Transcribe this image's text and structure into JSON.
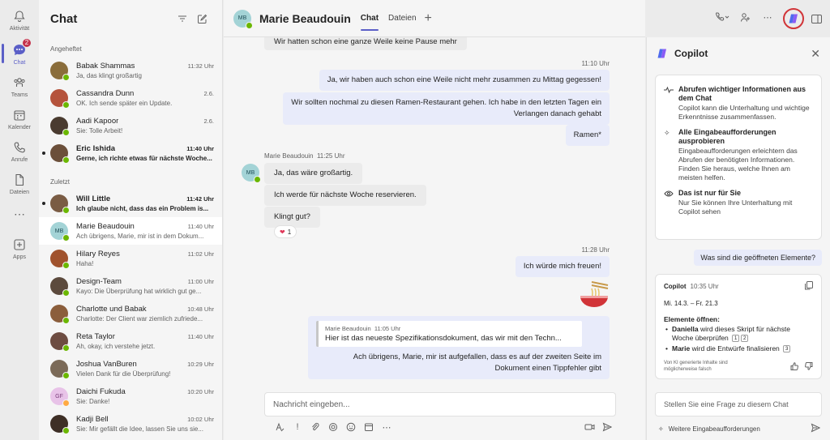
{
  "rail": {
    "items": [
      {
        "label": "Aktivität",
        "icon": "bell-icon"
      },
      {
        "label": "Chat",
        "icon": "chat-icon",
        "badge": "2"
      },
      {
        "label": "Teams",
        "icon": "teams-icon"
      },
      {
        "label": "Kalender",
        "icon": "calendar-icon"
      },
      {
        "label": "Anrufe",
        "icon": "phone-icon"
      },
      {
        "label": "Dateien",
        "icon": "file-icon"
      },
      {
        "label": "Apps",
        "icon": "plus-square-icon"
      }
    ]
  },
  "list": {
    "title": "Chat",
    "pinned_label": "Angeheftet",
    "recent_label": "Zuletzt",
    "pinned": [
      {
        "name": "Babak Shammas",
        "time": "11:32 Uhr",
        "preview": "Ja, das klingt großartig",
        "color": "#8a6d3b",
        "bold": false
      },
      {
        "name": "Cassandra Dunn",
        "time": "2.6.",
        "preview": "OK. Ich sende später ein Update.",
        "color": "#b5533c",
        "bold": false
      },
      {
        "name": "Aadi Kapoor",
        "time": "2.6.",
        "preview": "Sie: Tolle Arbeit!",
        "color": "#4a3b30",
        "bold": false
      },
      {
        "name": "Eric Ishida",
        "time": "11:40 Uhr",
        "preview": "Gerne, ich richte etwas für nächste Woche...",
        "color": "#6b4f3a",
        "bold": true
      }
    ],
    "recent": [
      {
        "name": "Will Little",
        "time": "11:42 Uhr",
        "preview": "Ich glaube nicht, dass das ein Problem is...",
        "color": "#7a5c44",
        "bold": true
      },
      {
        "name": "Marie Beaudouin",
        "time": "11:40 Uhr",
        "preview": "Ach übrigens, Marie, mir ist in dem Dokum...",
        "initials": "MB",
        "color": "#a3d3d6",
        "bold": false,
        "selected": true
      },
      {
        "name": "Hilary Reyes",
        "time": "11:02 Uhr",
        "preview": "Haha!",
        "color": "#a0522d",
        "bold": false
      },
      {
        "name": "Design-Team",
        "time": "11:00 Uhr",
        "preview": "Kayo: Die Überprüfung hat wirklich gut ge...",
        "color": "#5c4a3d",
        "bold": false
      },
      {
        "name": "Charlotte und Babak",
        "time": "10:48 Uhr",
        "preview": "Charlotte: Der Client war ziemlich zufriede...",
        "color": "#8b5e3c",
        "bold": false
      },
      {
        "name": "Reta Taylor",
        "time": "11:40 Uhr",
        "preview": "Ah, okay, ich verstehe jetzt.",
        "color": "#6d4c41",
        "bold": false
      },
      {
        "name": "Joshua VanBuren",
        "time": "10:29 Uhr",
        "preview": "Vielen Dank für die Überprüfung!",
        "color": "#7b6a58",
        "bold": false
      },
      {
        "name": "Daichi Fukuda",
        "time": "10:20 Uhr",
        "preview": "Sie: Danke!",
        "initials": "GF",
        "color": "#e8c3e8",
        "bold": false,
        "away": true
      },
      {
        "name": "Kadji Bell",
        "time": "10:02 Uhr",
        "preview": "Sie: Mir gefällt die Idee, lassen Sie uns sie...",
        "color": "#3e2f26",
        "bold": false
      }
    ]
  },
  "main": {
    "avatar_initials": "MB",
    "name": "Marie Beaudouin",
    "tabs": [
      "Chat",
      "Dateien"
    ],
    "messages": {
      "top_fragment": "Wir hatten schon eine ganze Weile keine Pause mehr",
      "out1_time": "11:10 Uhr",
      "out1a": "Ja, wir haben auch schon eine Weile nicht mehr zusammen zu Mittag gegessen!",
      "out1b_line1": "Wir sollten nochmal zu diesen Ramen-Restaurant gehen. Ich habe in den letzten Tagen ein",
      "out1b_line2": "Verlangen danach gehabt",
      "out1c": "Ramen*",
      "in_sender": "Marie Beaudouin",
      "in_time": "11:25 Uhr",
      "in1": "Ja, das wäre großartig.",
      "in2": "Ich werde für nächste Woche reservieren.",
      "in3": "Klingt gut?",
      "reaction_count": "1",
      "out2_time": "11:28 Uhr",
      "out2": "Ich würde mich freuen!",
      "quote_sender": "Marie Beaudouin",
      "quote_time": "11:05 Uhr",
      "quote_text": "Hier ist das neueste Spezifikationsdokument, das wir mit den Techn...",
      "reply_line1": "Ach übrigens, Marie, mir ist aufgefallen, dass es auf der zweiten Seite im",
      "reply_line2": "Dokument einen Tippfehler gibt"
    },
    "compose_placeholder": "Nachricht eingeben..."
  },
  "copilot": {
    "title": "Copilot",
    "features": [
      {
        "title": "Abrufen wichtiger Informationen aus dem Chat",
        "body": "Copilot kann die Unterhaltung und wichtige Erkenntnisse zusammenfassen.",
        "icon": "pulse-icon"
      },
      {
        "title": "Alle Eingabeaufforderungen ausprobieren",
        "body": "Eingabeaufforderungen erleichtern das Abrufen der benötigten Informationen. Finden Sie heraus, welche Ihnen am meisten helfen.",
        "icon": "sparkle-icon"
      },
      {
        "title": "Das ist nur für Sie",
        "body": "Nur Sie können Ihre Unterhaltung mit Copilot sehen",
        "icon": "eye-icon"
      }
    ],
    "user_question": "Was sind die geöffneten Elemente?",
    "answer": {
      "name": "Copilot",
      "time": "10:35 Uhr",
      "date_range": "Mi. 14.3. – Fr. 21.3",
      "heading": "Elemente öffnen:",
      "item1_name": "Daniella",
      "item1_rest": " wird dieses Skript für nächste Woche überprüfen",
      "item2_name": "Marie",
      "item2_rest": " wird die Entwürfe finalisieren",
      "ref1": "1",
      "ref2": "2",
      "ref3": "3",
      "disclaimer_line1": "Von KI generierte Inhalte sind",
      "disclaimer_line2": "möglicherweise falsch"
    },
    "input_placeholder": "Stellen Sie eine Frage zu diesem Chat",
    "more_prompts": "Weitere Eingabeaufforderungen"
  },
  "colors": {
    "accent": "#5b5fc7",
    "available": "#6bb700",
    "highlight": "#d13438"
  }
}
